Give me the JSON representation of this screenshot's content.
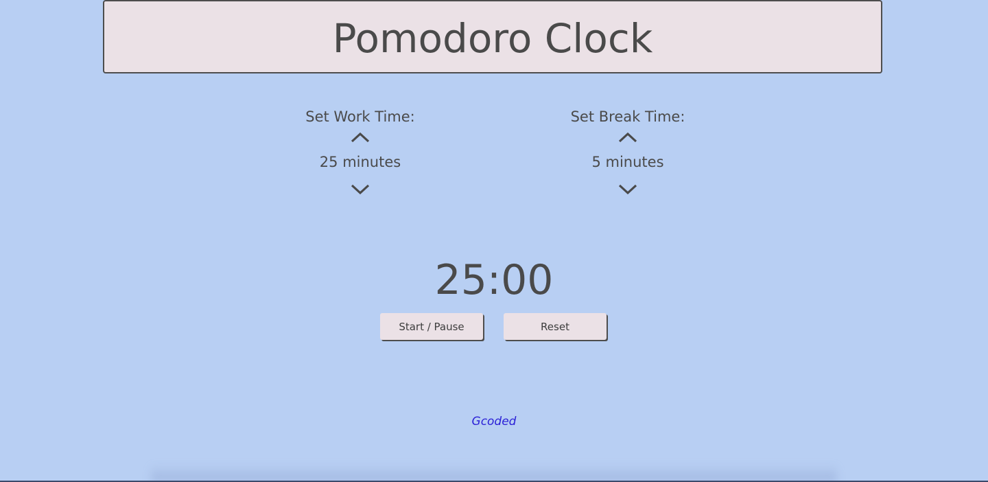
{
  "header": {
    "title": "Pomodoro Clock"
  },
  "work": {
    "label": "Set Work Time:",
    "value": "25 minutes",
    "increase_icon": "chevron-up-icon",
    "decrease_icon": "chevron-down-icon"
  },
  "break": {
    "label": "Set Break Time:",
    "value": "5 minutes",
    "increase_icon": "chevron-up-icon",
    "decrease_icon": "chevron-down-icon"
  },
  "timer": {
    "display": "25:00"
  },
  "controls": {
    "start_pause_label": "Start / Pause",
    "reset_label": "Reset"
  },
  "footer": {
    "link_text": "Gcoded"
  },
  "colors": {
    "background": "#b8cff3",
    "panel": "#ebe1e6",
    "text": "#4a4a4a",
    "link": "#2a1fd6"
  }
}
